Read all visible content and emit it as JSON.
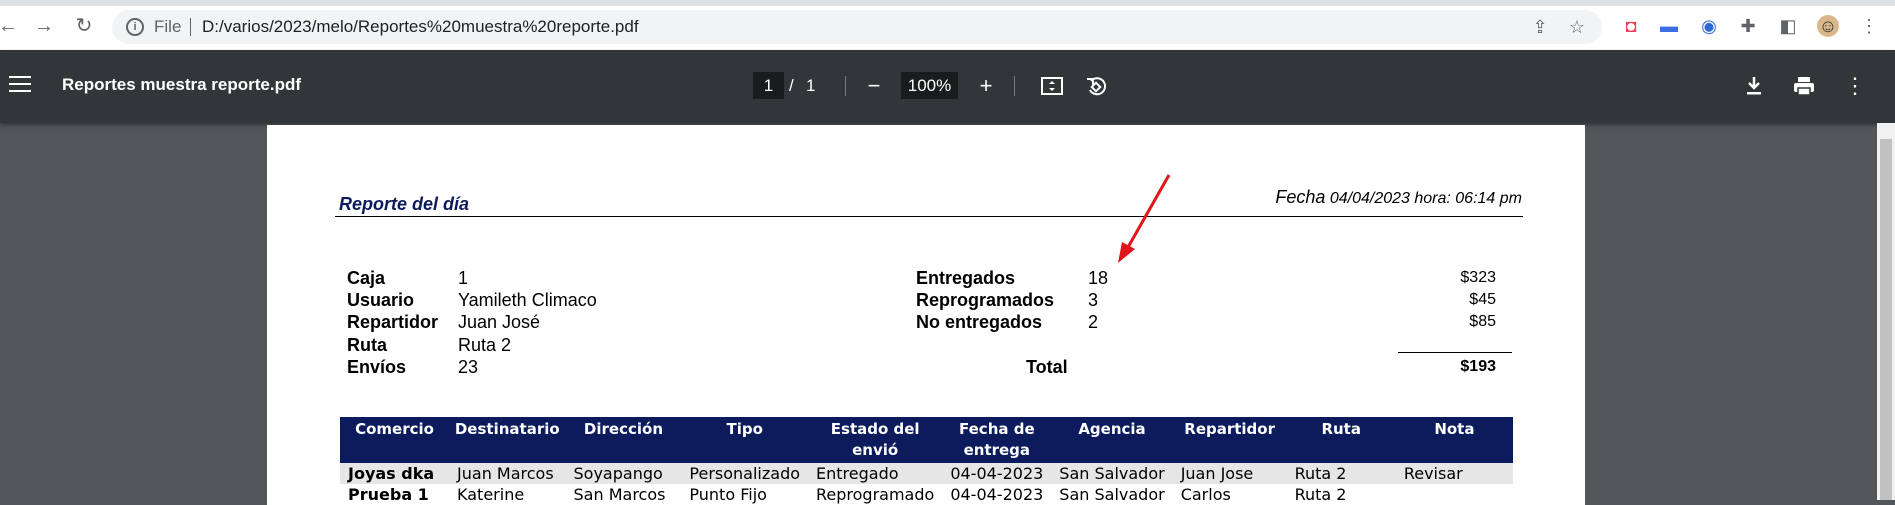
{
  "browser": {
    "file_label": "File",
    "url": "D:/varios/2023/melo/Reportes%20muestra%20reporte.pdf"
  },
  "viewer": {
    "title": "Reportes muestra reporte.pdf",
    "page_current": "1",
    "page_sep": "/",
    "page_total": "1",
    "zoom": "100%"
  },
  "report": {
    "title": "Reporte del día",
    "date_label": "Fecha",
    "date_value": "04/04/2023 hora: 06:14 pm",
    "left_info": [
      {
        "label": "Caja",
        "value": "1"
      },
      {
        "label": "Usuario",
        "value": "Yamileth Climaco"
      },
      {
        "label": "Repartidor",
        "value": "Juan José"
      },
      {
        "label": "Ruta",
        "value": "Ruta 2"
      },
      {
        "label": "Envíos",
        "value": "23"
      }
    ],
    "status_info": [
      {
        "label": "Entregados",
        "count": "18",
        "amount": "$323"
      },
      {
        "label": "Reprogramados",
        "count": "3",
        "amount": "$45"
      },
      {
        "label": "No entregados",
        "count": "2",
        "amount": "$85"
      }
    ],
    "total_label": "Total",
    "total_amount": "$193",
    "table": {
      "headers": [
        "Comercio",
        "Destinatario",
        "Dirección",
        "Tipo",
        "Estado del envió",
        "Fecha de entrega",
        "Agencia",
        "Repartidor",
        "Ruta",
        "Nota"
      ],
      "rows": [
        [
          "Joyas dka",
          "Juan Marcos",
          "Soyapango",
          "Personalizado",
          "Entregado",
          "04-04-2023",
          "San Salvador",
          "Juan Jose",
          "Ruta 2",
          "Revisar"
        ],
        [
          "Prueba 1",
          "Katerine",
          "San Marcos",
          "Punto Fijo",
          "Reprogramado",
          "04-04-2023",
          "San Salvador",
          "Carlos",
          "Ruta 2",
          ""
        ]
      ]
    }
  },
  "colors": {
    "header_navy": "#0b1b5c",
    "toolbar": "#323639",
    "arrow_red": "#e0161b"
  }
}
